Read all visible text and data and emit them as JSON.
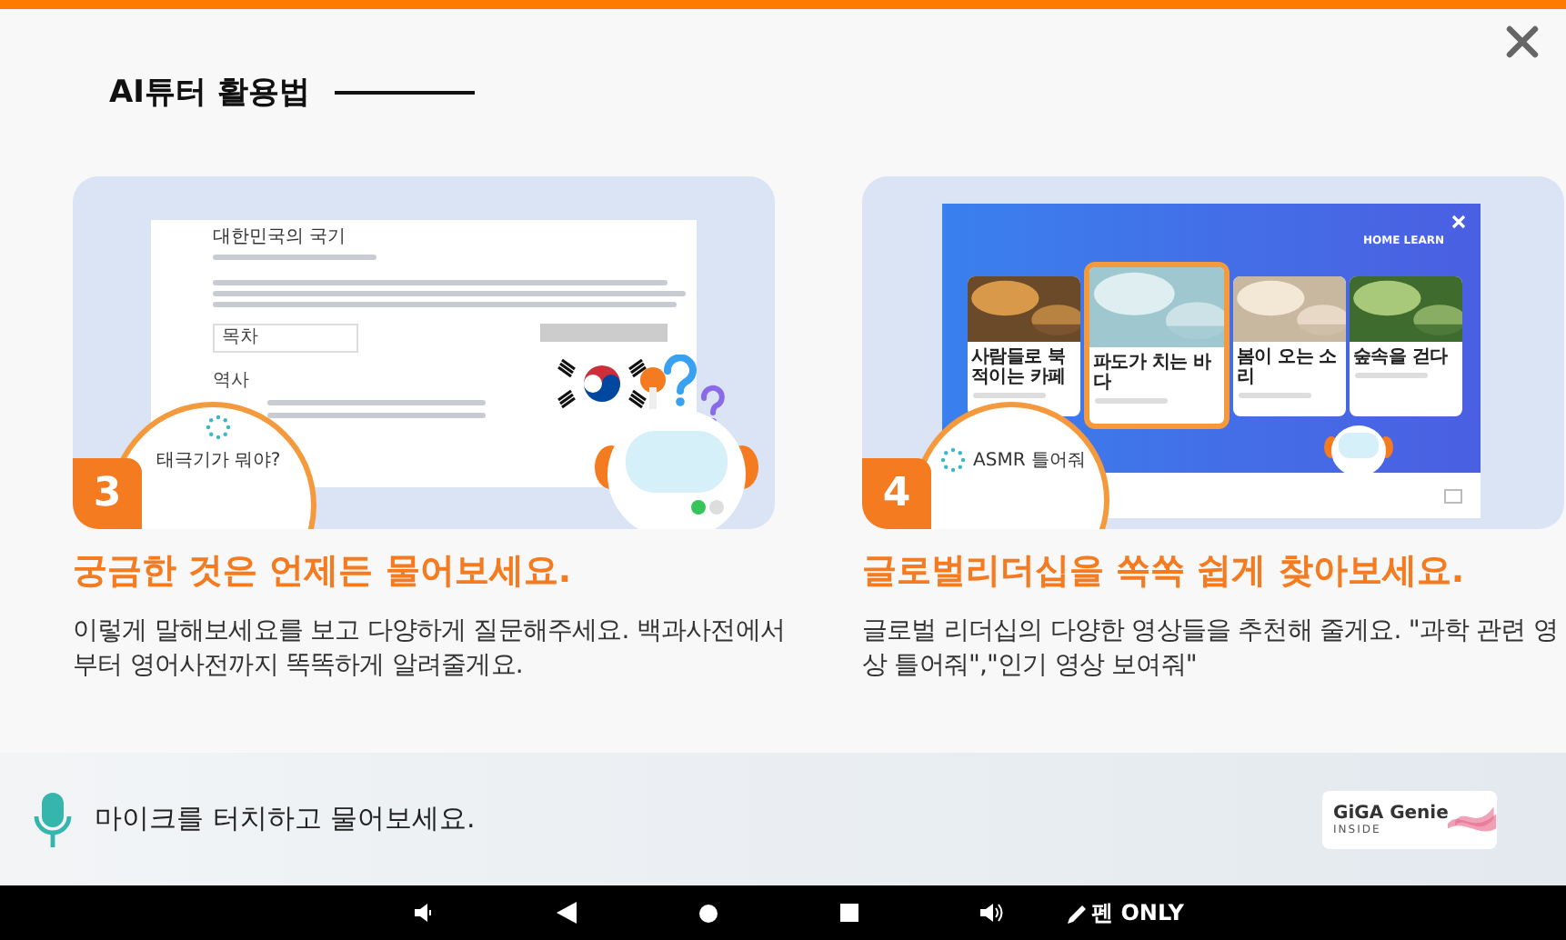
{
  "title": "AI튜터 활용법",
  "cards": [
    {
      "number": "3",
      "heading": "궁금한 것은 언제든 물어보세요.",
      "description": "이렇게 말해보세요를 보고 다양하게 질문해주세요. 백과사전에서 부터 영어사전까지 똑똑하게 알려줄게요.",
      "screen": {
        "kind": "wiki",
        "title": "대한민국의 국기",
        "toc": "목차",
        "section": "역사",
        "query": "태극기가 뭐야?"
      }
    },
    {
      "number": "4",
      "heading": "글로벌리더십을 쏙쏙 쉽게 찾아보세요.",
      "description": "글로벌 리더십의 다양한 영상들을 추천해 줄게요. \"과학 관련 영상 틀어줘\",\"인기 영상 보여줘\"",
      "screen": {
        "kind": "media",
        "logo": "HOME LEARN",
        "query": "ASMR 틀어줘",
        "tiles": [
          {
            "title": "사람들로 북적이는 카페",
            "selected": false
          },
          {
            "title": "파도가 치는 바다",
            "selected": true
          },
          {
            "title": "봄이 오는 소리",
            "selected": false
          },
          {
            "title": "숲속을 걷다",
            "selected": false
          }
        ]
      }
    }
  ],
  "voice_hint": "마이크를 터치하고 물어보세요.",
  "brand": {
    "name": "GiGA Genie",
    "sub": "INSIDE"
  },
  "nav": {
    "pen_label": "펜 ONLY"
  }
}
